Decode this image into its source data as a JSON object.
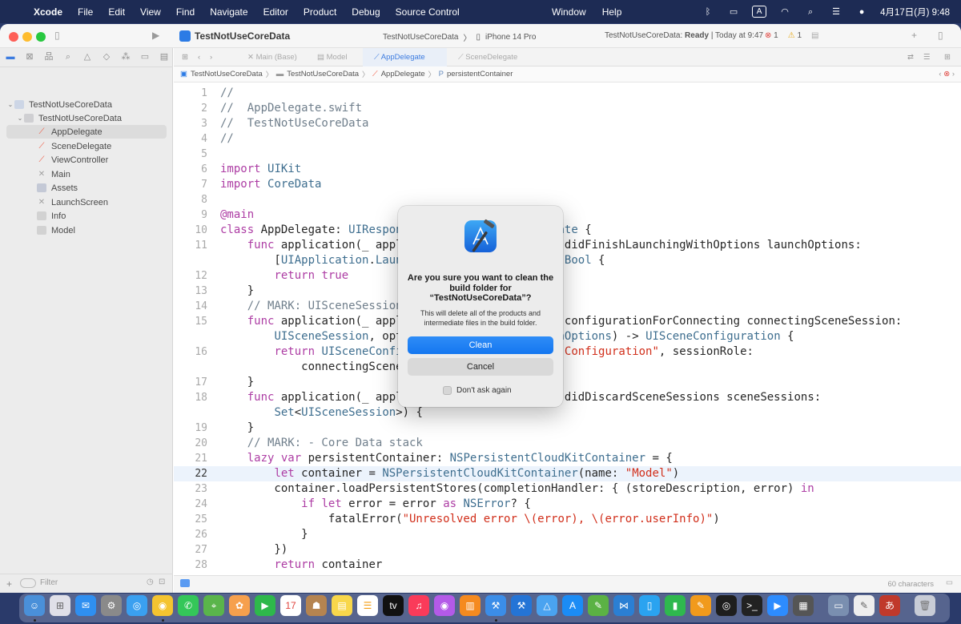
{
  "menubar": {
    "apple": "",
    "app": "Xcode",
    "items": [
      "File",
      "Edit",
      "View",
      "Find",
      "Navigate",
      "Editor",
      "Product",
      "Debug",
      "Source Control"
    ],
    "center_items": [
      "Window",
      "Help"
    ],
    "input_indicator": "A",
    "clock": "4月17日(月) 9:48"
  },
  "toolbar": {
    "project_title": "TestNotUseCoreData",
    "scheme": "TestNotUseCoreData",
    "scheme_sep": "〉",
    "device": "iPhone 14 Pro",
    "status_prefix": "TestNotUseCoreData: ",
    "status_state": "Ready",
    "status_suffix": " | Today at 9:47",
    "errors": "1",
    "warnings": "1"
  },
  "sidebar": {
    "project": "TestNotUseCoreData",
    "group": "TestNotUseCoreData",
    "files": [
      "AppDelegate",
      "SceneDelegate",
      "ViewController",
      "Main",
      "Assets",
      "LaunchScreen",
      "Info",
      "Model"
    ],
    "filter_placeholder": "Filter"
  },
  "tabs": [
    "Main (Base)",
    "Model",
    "AppDelegate",
    "SceneDelegate"
  ],
  "jumpbar": [
    "TestNotUseCoreData",
    "TestNotUseCoreData",
    "AppDelegate",
    "persistentContainer"
  ],
  "code": [
    {
      "n": "1",
      "t": "//"
    },
    {
      "n": "2",
      "t": "//  AppDelegate.swift"
    },
    {
      "n": "3",
      "t": "//  TestNotUseCoreData"
    },
    {
      "n": "4",
      "t": "//"
    },
    {
      "n": "5",
      "t": ""
    },
    {
      "n": "6",
      "t": "import UIKit"
    },
    {
      "n": "7",
      "t": "import CoreData"
    },
    {
      "n": "8",
      "t": ""
    },
    {
      "n": "9",
      "t": "@main"
    },
    {
      "n": "10",
      "t": "class AppDelegate: UIResponder, UIApplicationDelegate {"
    },
    {
      "n": "11",
      "t": "    func application(_ application: UIApplication, didFinishLaunchingWithOptions launchOptions:"
    },
    {
      "n": "",
      "t": "        [UIApplication.LaunchOptionsKey: Any]?) -> Bool {"
    },
    {
      "n": "12",
      "t": "        return true"
    },
    {
      "n": "13",
      "t": "    }"
    },
    {
      "n": "14",
      "t": "    // MARK: UISceneSession Lifecycle"
    },
    {
      "n": "15",
      "t": "    func application(_ application: UIApplication, configurationForConnecting connectingSceneSession:"
    },
    {
      "n": "",
      "t": "        UISceneSession, options: UIScene.ConnectionOptions) -> UISceneConfiguration {"
    },
    {
      "n": "16",
      "t": "        return UISceneConfiguration(name: \"Default Configuration\", sessionRole:"
    },
    {
      "n": "",
      "t": "            connectingSceneSession.role)"
    },
    {
      "n": "17",
      "t": "    }"
    },
    {
      "n": "18",
      "t": "    func application(_ application: UIApplication, didDiscardSceneSessions sceneSessions:"
    },
    {
      "n": "",
      "t": "        Set<UISceneSession>) {"
    },
    {
      "n": "19",
      "t": "    }"
    },
    {
      "n": "20",
      "t": "    // MARK: - Core Data stack"
    },
    {
      "n": "21",
      "t": "    lazy var persistentContainer: NSPersistentCloudKitContainer = {"
    },
    {
      "n": "22",
      "t": "        let container = NSPersistentCloudKitContainer(name: \"Model\")"
    },
    {
      "n": "23",
      "t": "        container.loadPersistentStores(completionHandler: { (storeDescription, error) in"
    },
    {
      "n": "24",
      "t": "            if let error = error as NSError? {"
    },
    {
      "n": "25",
      "t": "                fatalError(\"Unresolved error \\(error), \\(error.userInfo)\")"
    },
    {
      "n": "26",
      "t": "            }"
    },
    {
      "n": "27",
      "t": "        })"
    },
    {
      "n": "28",
      "t": "        return container"
    }
  ],
  "current_line": "22",
  "editor_status": "60 characters",
  "dialog": {
    "title": "Are you sure you want to clean the build folder for “TestNotUseCoreData”?",
    "message": "This will delete all of the products and intermediate files in the build folder.",
    "confirm_label": "Clean",
    "cancel_label": "Cancel",
    "checkbox_label": "Don't ask again"
  },
  "colors": {
    "keyword": "#ad3da4",
    "type": "#3e6e8f",
    "comment": "#707f8c",
    "string": "#d12f1b",
    "accent": "#1477f0"
  }
}
